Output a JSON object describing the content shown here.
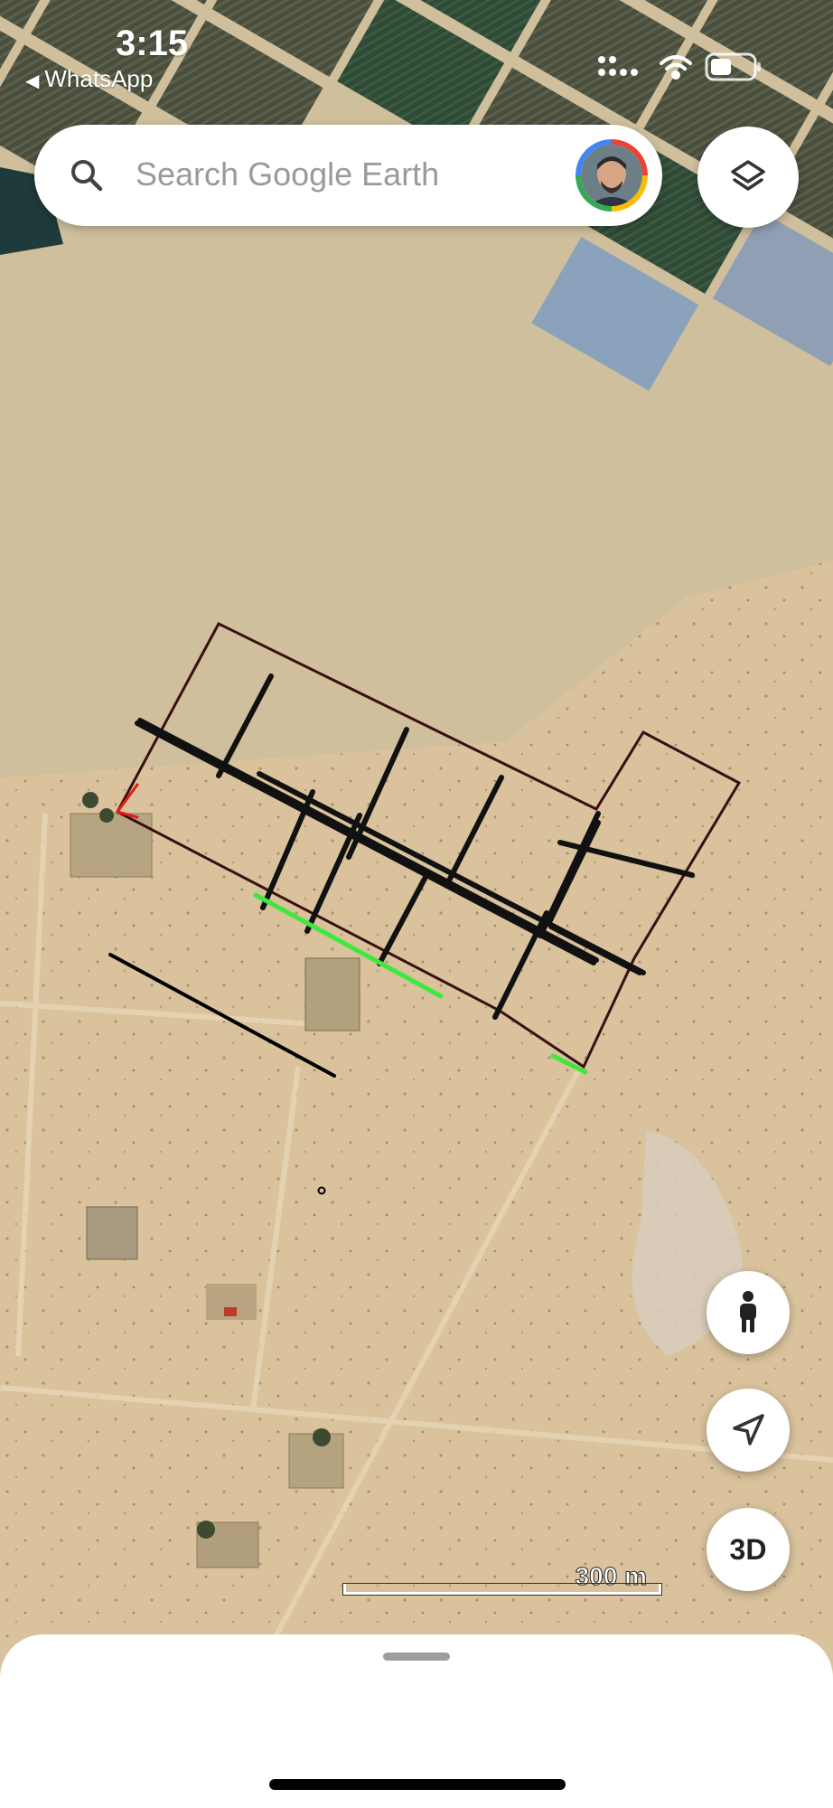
{
  "status_bar": {
    "time": "3:15",
    "back_app": "WhatsApp"
  },
  "search": {
    "placeholder": "Search Google Earth"
  },
  "controls": {
    "layers_icon": "layers-icon",
    "pegman_icon": "pegman-icon",
    "locate_icon": "navigation-arrow-icon",
    "three_d_label": "3D"
  },
  "scale": {
    "label": "300 m"
  },
  "colors": {
    "accent_red": "#e41b1b",
    "accent_green": "#3ee83e",
    "drawn_line": "#111111"
  }
}
